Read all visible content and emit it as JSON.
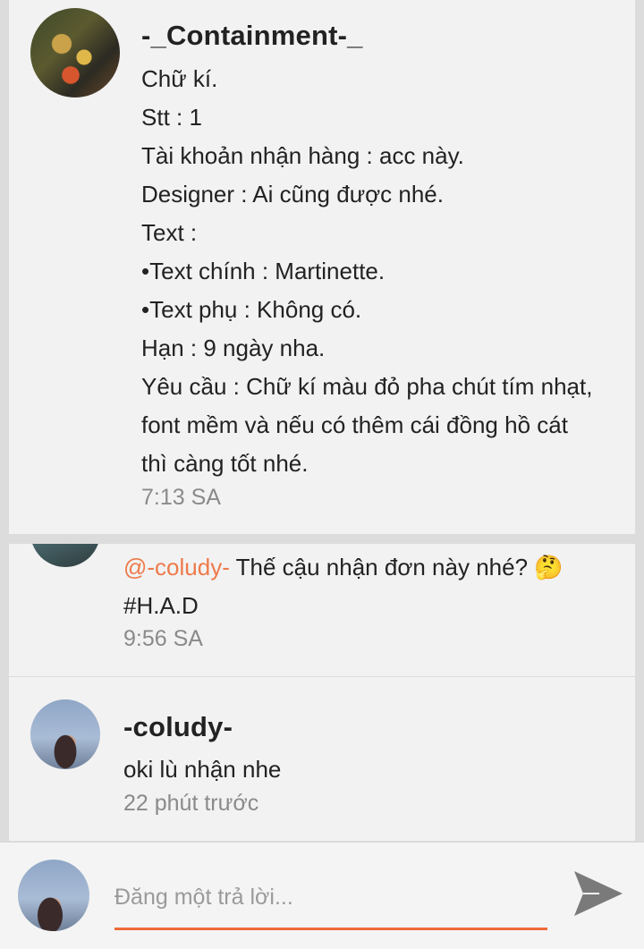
{
  "post": {
    "author": "-_Containment-_",
    "lines": [
      "Chữ kí.",
      "Stt : 1",
      "Tài khoản nhận hàng : acc này.",
      "Designer : Ai cũng được nhé.",
      "Text :",
      "•Text chính : Martinette.",
      "•Text phụ : Không có.",
      "Hạn : 9 ngày nha.",
      "Yêu cầu : Chữ kí màu đỏ pha chút tím nhạt,",
      "font mềm và nếu có thêm cái đồng hồ cát",
      "thì càng tốt nhé."
    ],
    "time": "7:13 SA"
  },
  "replies": [
    {
      "mention": "@-coludy-",
      "text": " Thế cậu nhận đơn này nhé? 🤔",
      "tag": "#H.A.D",
      "time": "9:56 SA"
    },
    {
      "author": "-coludy-",
      "text": "oki lù nhận nhe",
      "time": "22 phút trước"
    }
  ],
  "composer": {
    "placeholder": "Đăng một trả lời..."
  },
  "colors": {
    "accent": "#ee6b3a",
    "mention": "#ee7a4a",
    "card_bg": "#f2f2f2",
    "page_bg": "#dcdcdc",
    "muted_text": "#8a8a8a"
  },
  "icons": {
    "send": "send-icon"
  }
}
